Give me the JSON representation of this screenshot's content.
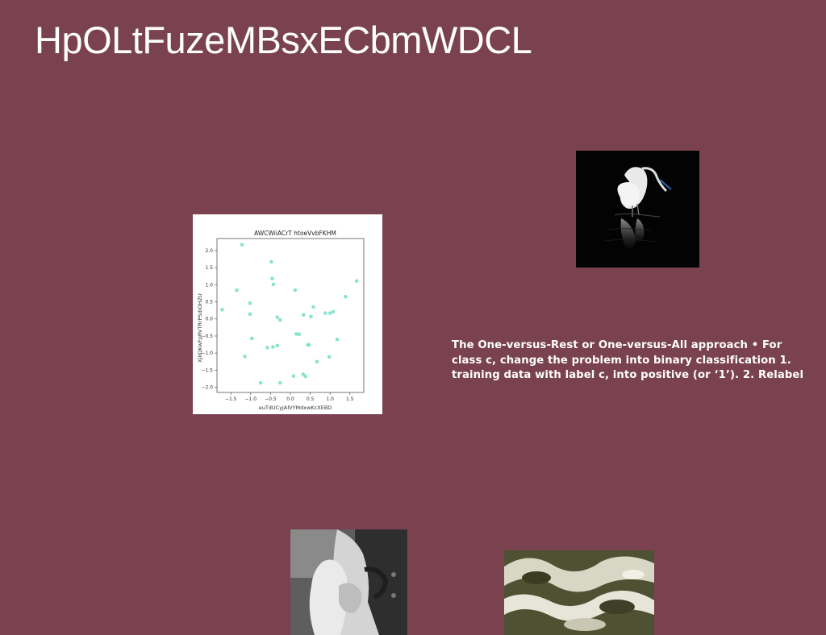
{
  "title": "HpOLtFuzeMBsxECbmWDCL",
  "body_text": {
    "lines": [
      "The One-versus-Rest or One-versus-All approach • For",
      "class c, change the problem into binary classification 1.",
      "training data with label c, into positive (or ‘1’). 2. Relabel"
    ]
  },
  "images": {
    "egret": "egret-photo",
    "couple": "couple-photo",
    "water": "water-photo"
  },
  "chart_data": {
    "type": "scatter",
    "title": "AWCWiiACrT htoeVvbFKHM",
    "xlabel": "euTdUCyjAlVYMdxwKcXEBD",
    "ylabel": "XjIIQKwFpRVTRrPSdiOHZU",
    "xlim": [
      -1.85,
      1.85
    ],
    "ylim": [
      -2.15,
      2.35
    ],
    "xticks": [
      -1.5,
      -1.0,
      -0.5,
      0.0,
      0.5,
      1.0,
      1.5
    ],
    "xtick_labels": [
      "−1.5",
      "−1.0",
      "−0.5",
      "0.0",
      "0.5",
      "1.0",
      "1.5"
    ],
    "yticks": [
      -2.0,
      -1.5,
      -1.0,
      -0.5,
      0.0,
      0.5,
      1.0,
      1.5,
      2.0
    ],
    "ytick_labels": [
      "−2.0",
      "−1.5",
      "−1.0",
      "−0.5",
      "0.0",
      "0.5",
      "1.0",
      "1.5",
      "2.0"
    ],
    "grid": false,
    "color": "#7fdfc9",
    "points": [
      {
        "x": -1.72,
        "y": 0.27
      },
      {
        "x": -1.35,
        "y": 0.84
      },
      {
        "x": -1.22,
        "y": 2.17
      },
      {
        "x": -1.15,
        "y": -1.1
      },
      {
        "x": -1.02,
        "y": 0.46
      },
      {
        "x": -1.02,
        "y": 0.14
      },
      {
        "x": -0.97,
        "y": -0.57
      },
      {
        "x": -0.75,
        "y": -1.87
      },
      {
        "x": -0.58,
        "y": -0.84
      },
      {
        "x": -0.48,
        "y": 1.67
      },
      {
        "x": -0.46,
        "y": 1.18
      },
      {
        "x": -0.43,
        "y": 1.01
      },
      {
        "x": -0.44,
        "y": -0.82
      },
      {
        "x": -0.33,
        "y": -0.78
      },
      {
        "x": -0.33,
        "y": 0.05
      },
      {
        "x": -0.26,
        "y": -0.03
      },
      {
        "x": -0.26,
        "y": -1.87
      },
      {
        "x": 0.08,
        "y": -1.67
      },
      {
        "x": 0.12,
        "y": 0.84
      },
      {
        "x": 0.15,
        "y": -0.44
      },
      {
        "x": 0.22,
        "y": -0.45
      },
      {
        "x": 0.32,
        "y": -1.62
      },
      {
        "x": 0.33,
        "y": 0.12
      },
      {
        "x": 0.38,
        "y": -1.68
      },
      {
        "x": 0.44,
        "y": -0.76
      },
      {
        "x": 0.47,
        "y": -0.76
      },
      {
        "x": 0.52,
        "y": 0.07
      },
      {
        "x": 0.58,
        "y": 0.35
      },
      {
        "x": 0.67,
        "y": -1.25
      },
      {
        "x": 0.88,
        "y": 0.17
      },
      {
        "x": 0.98,
        "y": -1.11
      },
      {
        "x": 1.0,
        "y": 0.17
      },
      {
        "x": 1.08,
        "y": 0.21
      },
      {
        "x": 1.18,
        "y": -0.6
      },
      {
        "x": 1.39,
        "y": 0.65
      },
      {
        "x": 1.67,
        "y": 1.11
      }
    ]
  }
}
